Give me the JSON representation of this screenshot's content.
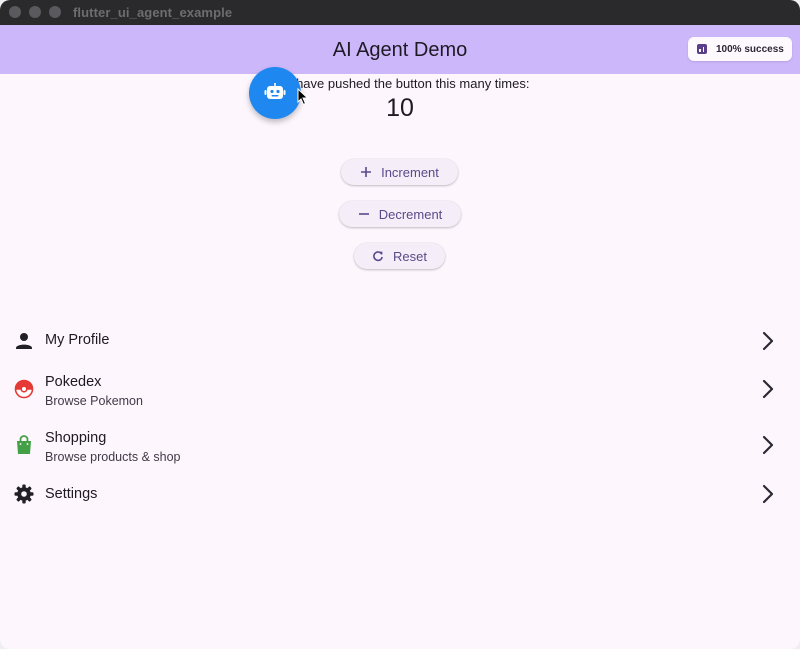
{
  "window": {
    "title": "flutter_ui_agent_example"
  },
  "appbar": {
    "title": "AI Agent Demo",
    "success_chip": {
      "label": "100% success",
      "icon": "analytics-icon"
    }
  },
  "counter": {
    "message": "You have pushed the button this many times:",
    "value": "10"
  },
  "fab": {
    "icon": "robot-icon",
    "color": "#1e88f0"
  },
  "buttons": {
    "increment": {
      "label": "Increment",
      "icon": "plus-icon"
    },
    "decrement": {
      "label": "Decrement",
      "icon": "minus-icon"
    },
    "reset": {
      "label": "Reset",
      "icon": "refresh-icon"
    }
  },
  "menu": {
    "items": [
      {
        "title": "My Profile",
        "subtitle": "",
        "icon": "person-icon"
      },
      {
        "title": "Pokedex",
        "subtitle": "Browse Pokemon",
        "icon": "pokeball-icon"
      },
      {
        "title": "Shopping",
        "subtitle": "Browse products & shop",
        "icon": "shopping-bag-icon"
      },
      {
        "title": "Settings",
        "subtitle": "",
        "icon": "gear-icon"
      }
    ]
  },
  "colors": {
    "appbar": "#cdb7fb",
    "background": "#fdf7fd",
    "button_text": "#5a4a8a",
    "pokeball": "#e53935",
    "shopping": "#43a047"
  }
}
